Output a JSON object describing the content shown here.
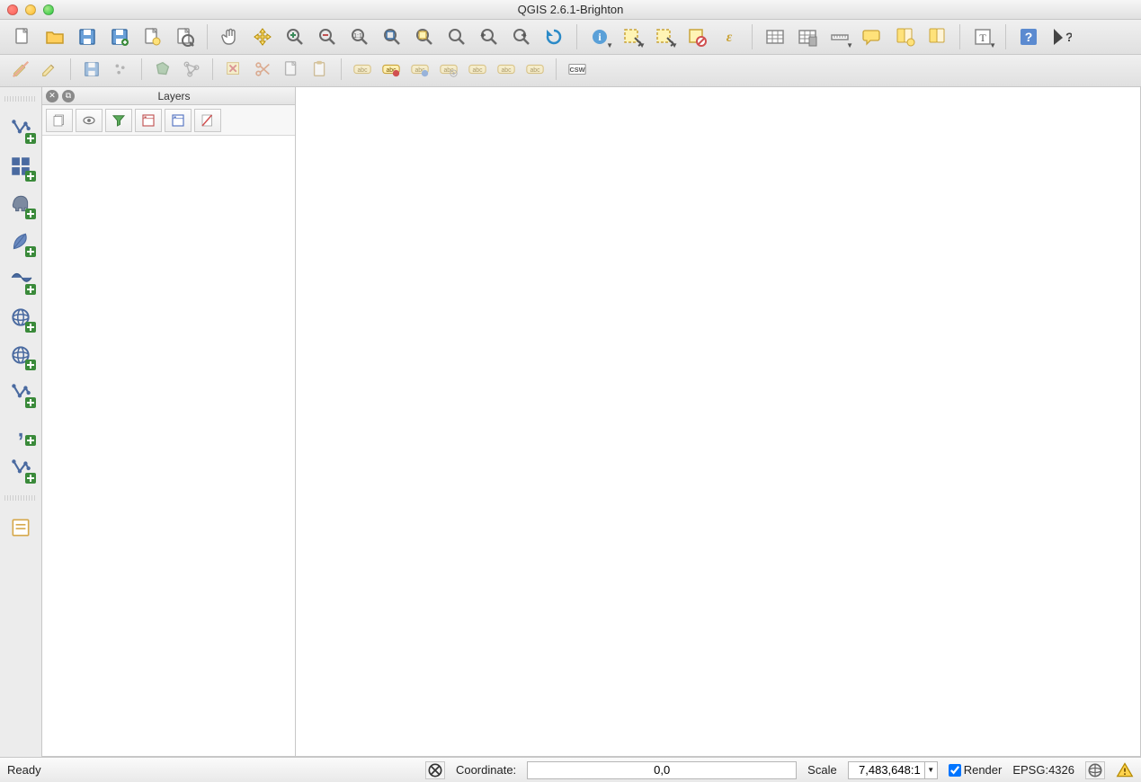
{
  "window": {
    "title": "QGIS 2.6.1-Brighton"
  },
  "toolbar1": {
    "items": [
      {
        "name": "new-project-icon"
      },
      {
        "name": "open-project-icon"
      },
      {
        "name": "save-project-icon"
      },
      {
        "name": "save-project-as-icon"
      },
      {
        "name": "new-print-composer-icon"
      },
      {
        "name": "composer-manager-icon"
      },
      {
        "sep": true
      },
      {
        "name": "pan-icon"
      },
      {
        "name": "pan-to-selection-icon"
      },
      {
        "name": "zoom-in-icon"
      },
      {
        "name": "zoom-out-icon"
      },
      {
        "name": "zoom-native-icon"
      },
      {
        "name": "zoom-full-icon"
      },
      {
        "name": "zoom-to-selection-icon"
      },
      {
        "name": "zoom-to-layer-icon"
      },
      {
        "name": "zoom-last-icon"
      },
      {
        "name": "zoom-next-icon"
      },
      {
        "name": "refresh-icon"
      },
      {
        "sep": true
      },
      {
        "name": "identify-icon",
        "dd": true
      },
      {
        "name": "select-icon",
        "dd": true
      },
      {
        "name": "select-by-expression-icon",
        "dd": true
      },
      {
        "name": "deselect-icon"
      },
      {
        "name": "expression-icon"
      },
      {
        "sep": true
      },
      {
        "name": "open-attribute-table-icon"
      },
      {
        "name": "field-calculator-icon"
      },
      {
        "name": "measure-icon",
        "dd": true
      },
      {
        "name": "map-tips-icon"
      },
      {
        "name": "new-bookmark-icon"
      },
      {
        "name": "show-bookmarks-icon"
      },
      {
        "sep": true
      },
      {
        "name": "text-annotation-icon",
        "dd": true
      },
      {
        "sep": true
      },
      {
        "name": "help-icon"
      },
      {
        "name": "whats-this-icon"
      }
    ]
  },
  "toolbar2": {
    "items": [
      {
        "name": "current-edits-icon",
        "disabled": true
      },
      {
        "name": "toggle-editing-icon",
        "disabled": true
      },
      {
        "sep": true
      },
      {
        "name": "save-layer-edits-icon",
        "disabled": true
      },
      {
        "name": "add-feature-icon",
        "disabled": true
      },
      {
        "sep": true
      },
      {
        "name": "move-feature-icon",
        "disabled": true
      },
      {
        "name": "node-tool-icon",
        "disabled": true
      },
      {
        "sep": true
      },
      {
        "name": "delete-selected-icon",
        "disabled": true
      },
      {
        "name": "cut-features-icon",
        "disabled": true
      },
      {
        "name": "copy-features-icon",
        "disabled": true
      },
      {
        "name": "paste-features-icon",
        "disabled": true
      },
      {
        "sep": true
      },
      {
        "name": "label-tool-icon",
        "disabled": true
      },
      {
        "name": "label-highlight-icon"
      },
      {
        "name": "label-pin-icon",
        "disabled": true
      },
      {
        "name": "label-show-icon",
        "disabled": true
      },
      {
        "name": "label-move-icon",
        "disabled": true
      },
      {
        "name": "label-rotate-icon",
        "disabled": true
      },
      {
        "name": "label-change-icon",
        "disabled": true
      },
      {
        "sep": true
      },
      {
        "name": "csw-icon",
        "label": "CSW"
      }
    ]
  },
  "left_dock": {
    "items": [
      {
        "name": "add-vector-layer-icon"
      },
      {
        "name": "add-raster-layer-icon"
      },
      {
        "name": "add-postgis-layer-icon"
      },
      {
        "name": "add-spatialite-layer-icon"
      },
      {
        "name": "add-mssql-layer-icon"
      },
      {
        "name": "add-wms-layer-icon"
      },
      {
        "name": "add-wcs-layer-icon"
      },
      {
        "name": "add-wfs-layer-icon"
      },
      {
        "name": "add-delimited-text-icon"
      },
      {
        "name": "add-virtual-layer-icon"
      },
      {
        "name": "new-shapefile-icon"
      }
    ]
  },
  "layers_panel": {
    "title": "Layers",
    "toolbar": [
      {
        "name": "layer-styling-icon"
      },
      {
        "name": "add-group-icon"
      },
      {
        "name": "filter-legend-icon"
      },
      {
        "name": "expand-all-icon"
      },
      {
        "name": "collapse-all-icon"
      },
      {
        "name": "remove-layer-icon"
      }
    ]
  },
  "statusbar": {
    "ready": "Ready",
    "coordinate_label": "Coordinate:",
    "coordinate_value": "0,0",
    "scale_label": "Scale",
    "scale_value": "7,483,648:1",
    "render_label": "Render",
    "render_checked": true,
    "crs_label": "EPSG:4326"
  }
}
